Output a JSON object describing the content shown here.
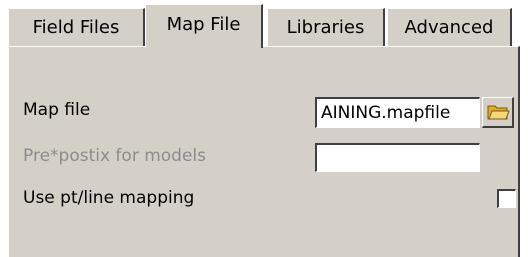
{
  "tabs": [
    {
      "label": "Field Files",
      "active": false
    },
    {
      "label": "Map File",
      "active": true
    },
    {
      "label": "Libraries",
      "active": false
    },
    {
      "label": "Advanced",
      "active": false
    }
  ],
  "map_file": {
    "label": "Map file",
    "value": "AINING.mapfile",
    "browse_icon": "folder-open-icon"
  },
  "prefix": {
    "label": "Pre*postix for models",
    "value": "",
    "enabled": false
  },
  "mapping": {
    "label": "Use pt/line mapping",
    "checked": false
  },
  "colors": {
    "panel_bg": "#d4d0c8",
    "disabled_text": "#8c8c8c",
    "folder": "#f2c94c"
  }
}
